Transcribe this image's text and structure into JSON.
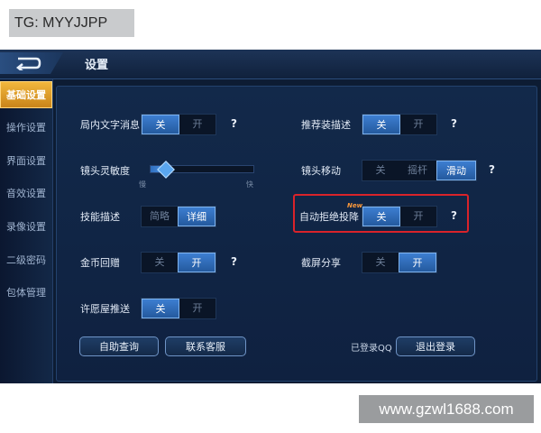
{
  "watermarks": {
    "top": "TG: MYYJJPP",
    "bottom": "www.gzwl1688.com"
  },
  "header": {
    "title": "设置",
    "back_icon": "back-arrow-icon"
  },
  "sidebar": {
    "items": [
      {
        "label": "基础设置",
        "active": true
      },
      {
        "label": "操作设置",
        "active": false
      },
      {
        "label": "界面设置",
        "active": false
      },
      {
        "label": "音效设置",
        "active": false
      },
      {
        "label": "录像设置",
        "active": false
      },
      {
        "label": "二级密码",
        "active": false
      },
      {
        "label": "包体管理",
        "active": false
      }
    ]
  },
  "settings": {
    "chat": {
      "label": "局内文字消息",
      "off": "关",
      "on": "开",
      "selected": "off",
      "help": "?"
    },
    "recommend_gear": {
      "label": "推荐装描述",
      "off": "关",
      "on": "开",
      "selected": "off",
      "help": "?"
    },
    "camera_sensitivity": {
      "label": "镜头灵敏度",
      "slow": "慢",
      "fast": "快",
      "value_fraction": 0.15
    },
    "camera_move": {
      "label": "镜头移动",
      "options": [
        "关",
        "摇杆",
        "滑动"
      ],
      "selected": "滑动",
      "help": "?"
    },
    "skill_desc": {
      "label": "技能描述",
      "brief": "简略",
      "detail": "详细",
      "selected": "detail"
    },
    "auto_reject_surrender": {
      "label": "自动拒绝投降",
      "badge": "New",
      "off": "关",
      "on": "开",
      "selected": "off",
      "help": "?"
    },
    "gold_return": {
      "label": "金币回赠",
      "off": "关",
      "on": "开",
      "selected": "on",
      "help": "?"
    },
    "screenshot_share": {
      "label": "截屏分享",
      "off": "关",
      "on": "开",
      "selected": "on"
    },
    "wish_push": {
      "label": "许愿屋推送",
      "off": "关",
      "on": "开",
      "selected": "off"
    }
  },
  "footer": {
    "help_query": "自助查询",
    "contact_service": "联系客服",
    "logged_in": "已登录QQ",
    "logout": "退出登录"
  },
  "colors": {
    "accent_on": "#3d7ed1",
    "sidebar_active": "#f2b73d",
    "highlight_box": "#d9232a"
  }
}
